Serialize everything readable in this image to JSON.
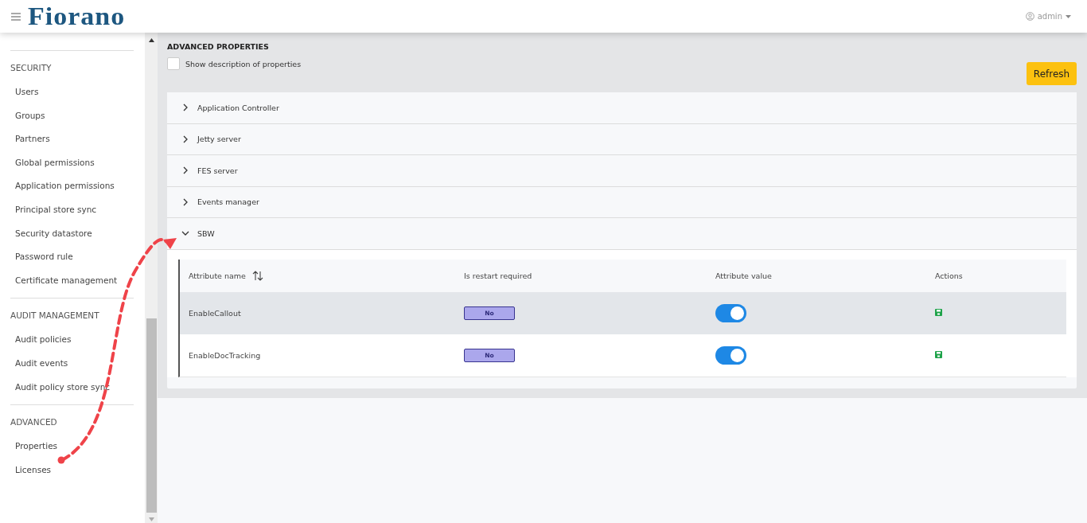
{
  "header": {
    "logo": "Fiorano",
    "user": "admin"
  },
  "sidebar": {
    "sections": [
      {
        "title": "SECURITY",
        "items": [
          "Users",
          "Groups",
          "Partners",
          "Global permissions",
          "Application permissions",
          "Principal store sync",
          "Security datastore",
          "Password rule",
          "Certificate management"
        ]
      },
      {
        "title": "AUDIT MANAGEMENT",
        "items": [
          "Audit policies",
          "Audit events",
          "Audit policy store sync"
        ]
      },
      {
        "title": "ADVANCED",
        "items": [
          "Properties",
          "Licenses"
        ]
      }
    ]
  },
  "page": {
    "title": "ADVANCED PROPERTIES",
    "show_description": {
      "label": "Show description of properties",
      "checked": false
    },
    "refresh_button": "Refresh"
  },
  "accordion": [
    {
      "label": "Application Controller",
      "expanded": false
    },
    {
      "label": "Jetty server",
      "expanded": false
    },
    {
      "label": "FES server",
      "expanded": false
    },
    {
      "label": "Events manager",
      "expanded": false
    },
    {
      "label": "SBW",
      "expanded": true,
      "table": {
        "columns": [
          "Attribute name",
          "Is restart required",
          "Attribute value",
          "Actions"
        ],
        "rows": [
          {
            "name": "EnableCallout",
            "restart": "No",
            "on": true,
            "highlighted": true
          },
          {
            "name": "EnableDocTracking",
            "restart": "No",
            "on": true,
            "highlighted": false
          }
        ]
      }
    }
  ],
  "annotation": {
    "kind": "arrow"
  }
}
